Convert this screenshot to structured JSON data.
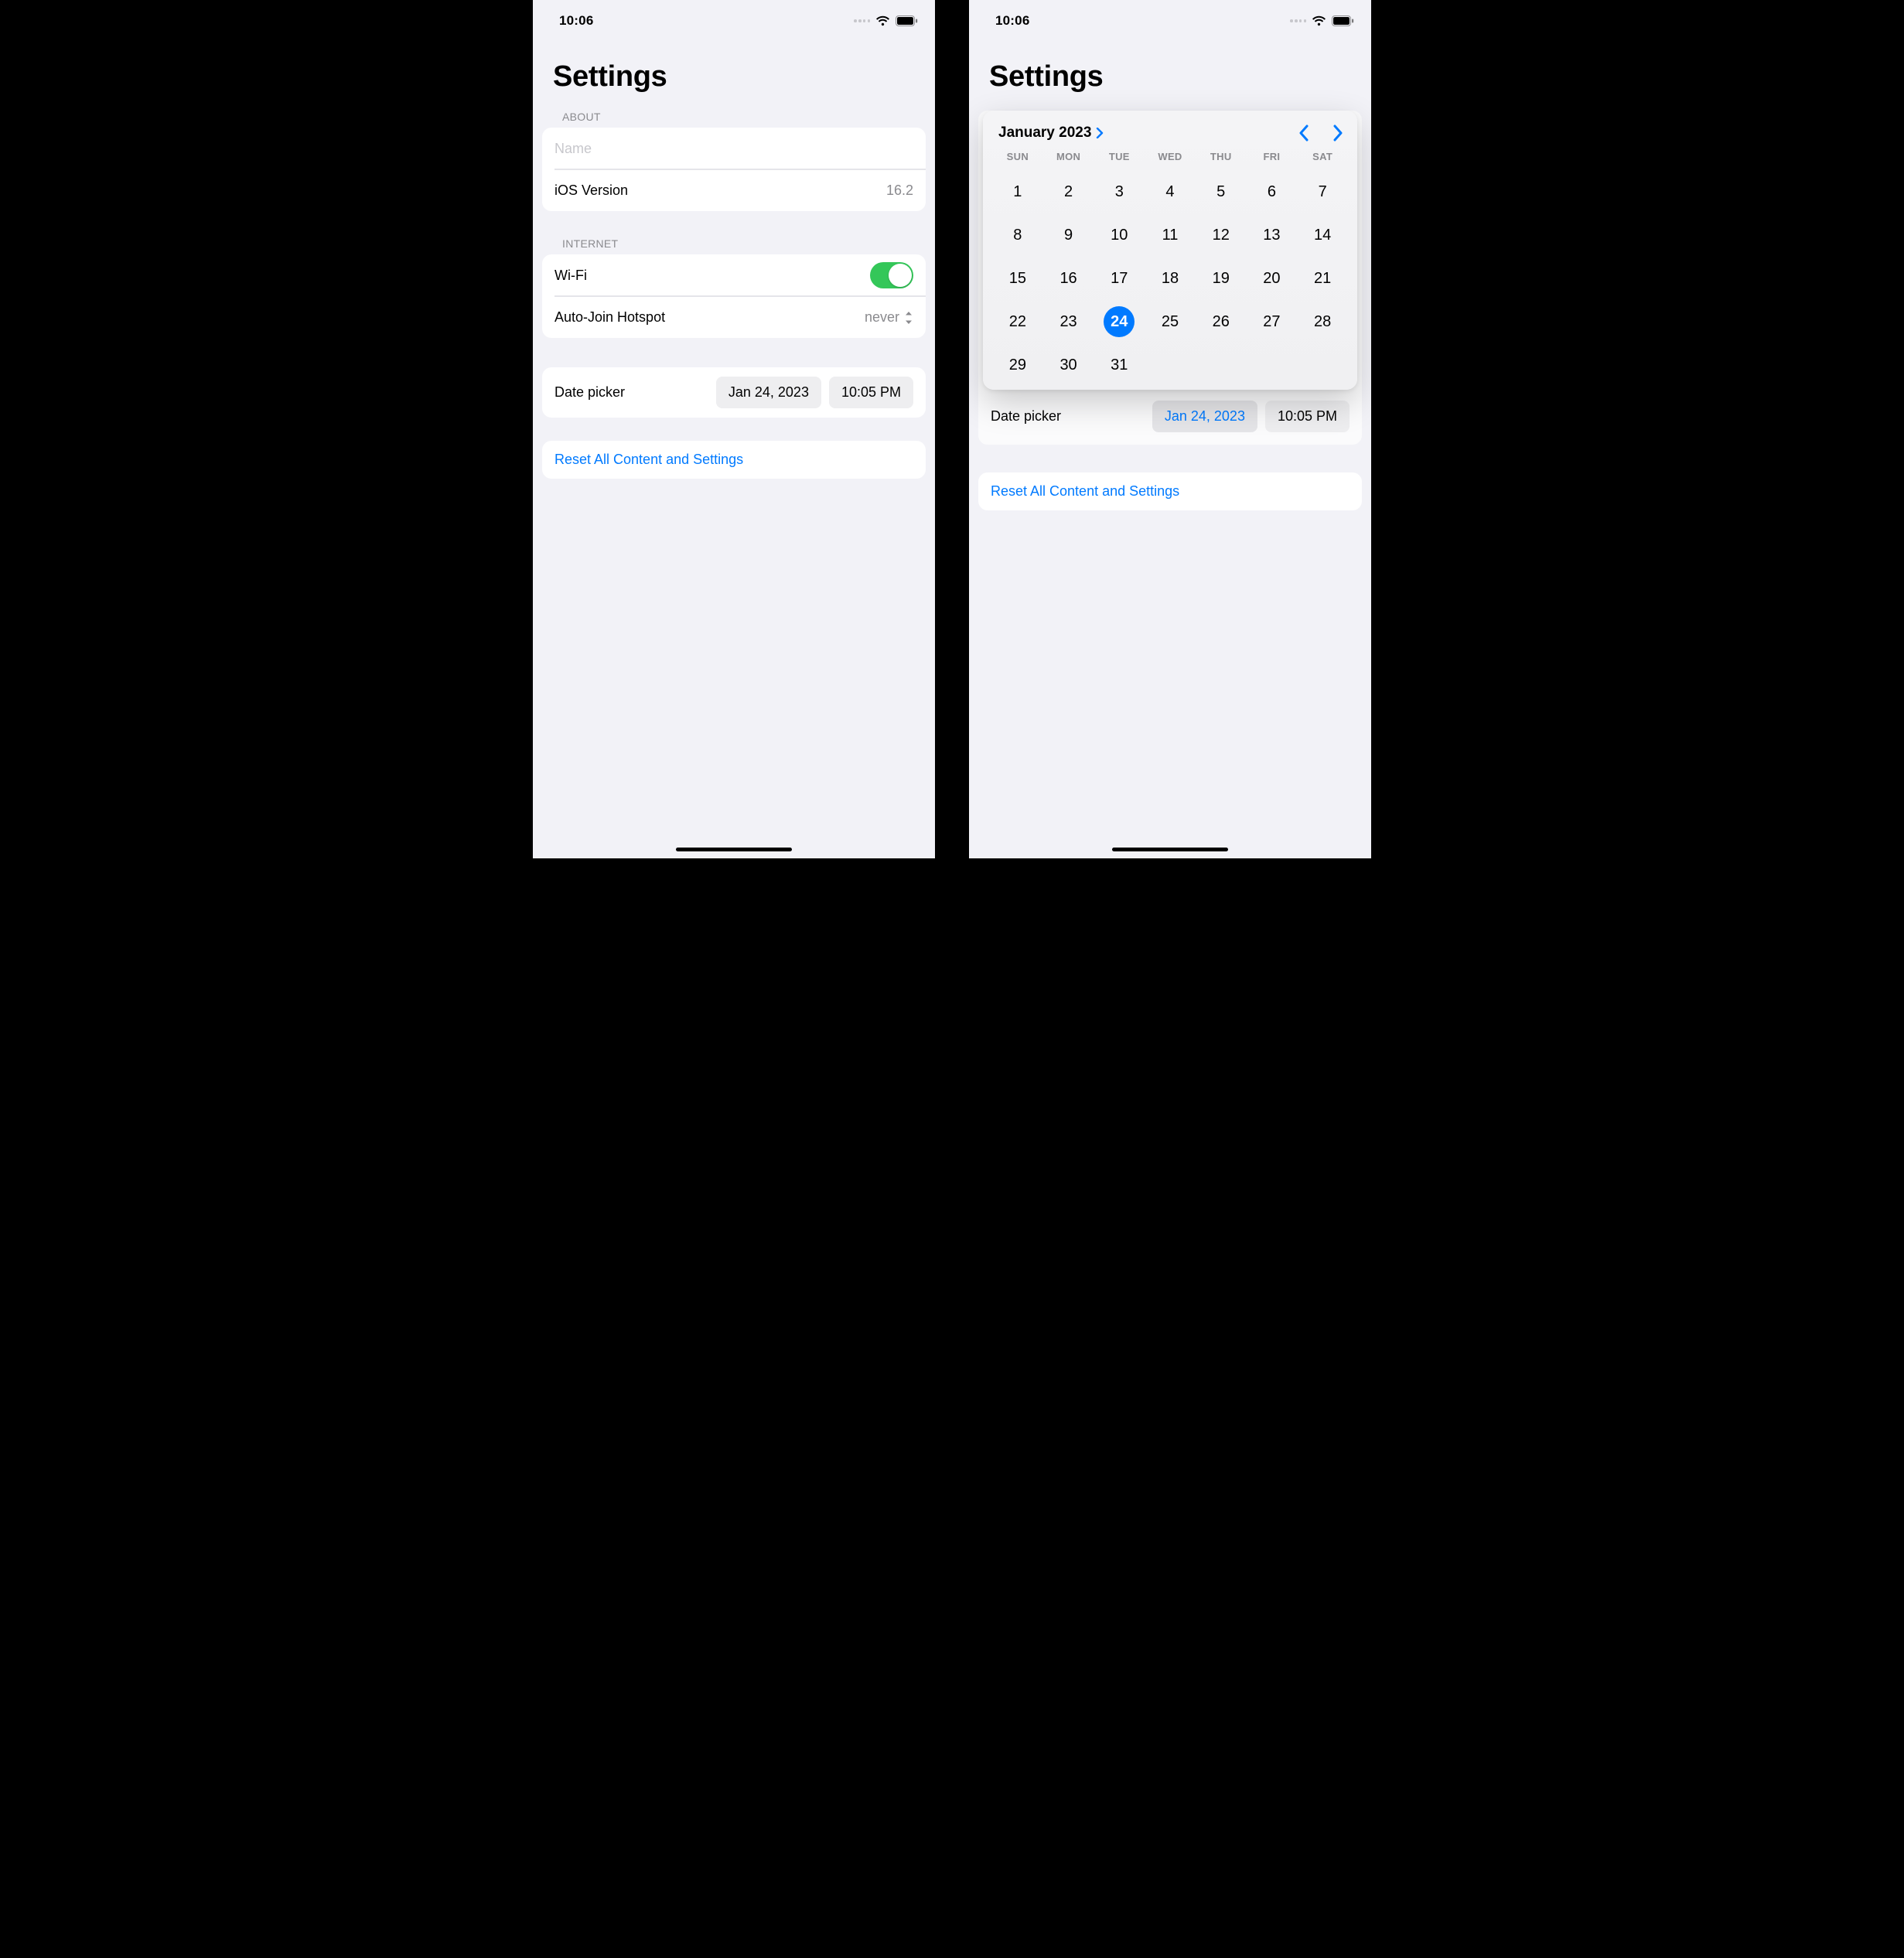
{
  "status": {
    "time": "10:06"
  },
  "page_title": "Settings",
  "about": {
    "header": "ABOUT",
    "name_placeholder": "Name",
    "name_value": "",
    "ios_label": "iOS Version",
    "ios_value": "16.2"
  },
  "internet": {
    "header": "INTERNET",
    "wifi_label": "Wi-Fi",
    "wifi_on": true,
    "hotspot_label": "Auto-Join Hotspot",
    "hotspot_value": "never"
  },
  "datepicker": {
    "label": "Date picker",
    "date_value": "Jan 24, 2023",
    "time_value": "10:05 PM"
  },
  "reset_label": "Reset All Content and Settings",
  "calendar": {
    "title": "January 2023",
    "dow": [
      "SUN",
      "MON",
      "TUE",
      "WED",
      "THU",
      "FRI",
      "SAT"
    ],
    "first_day_index": 0,
    "days_in_month": 31,
    "selected_day": 24
  },
  "colors": {
    "accent": "#007aff",
    "toggle_on": "#34c759",
    "bg": "#f2f2f7"
  }
}
